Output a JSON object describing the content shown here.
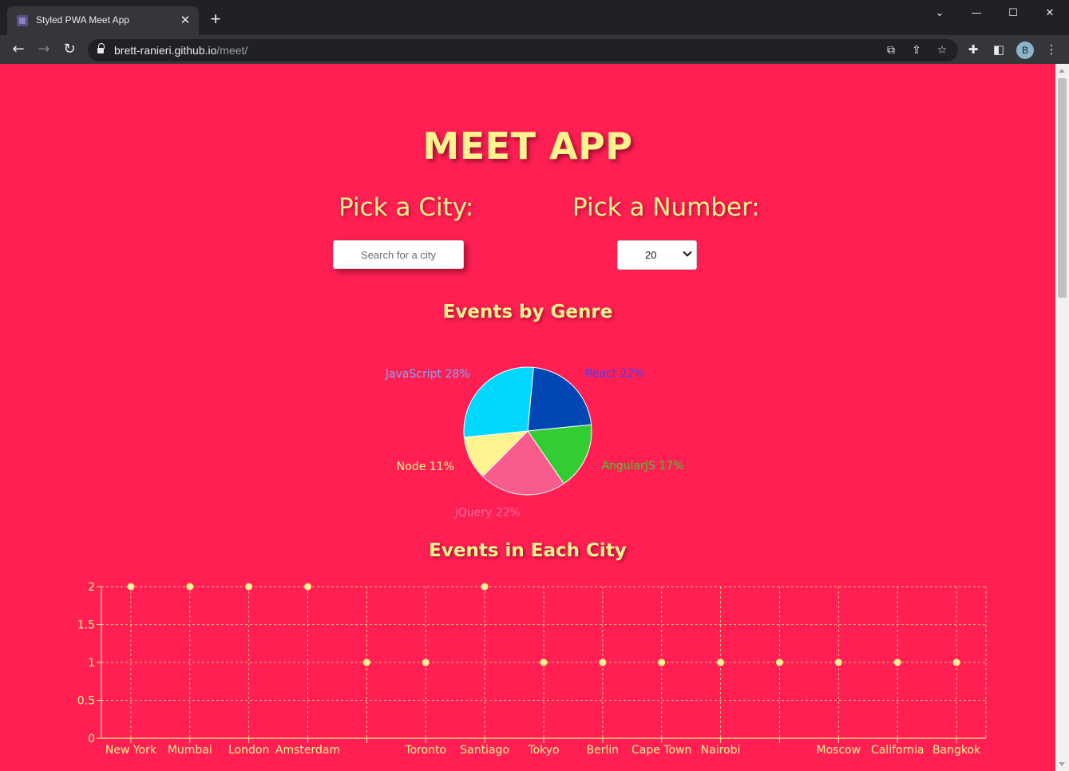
{
  "browser": {
    "tab_title": "Styled PWA Meet App",
    "url_host": "brett-ranieri.github.io",
    "url_path": "/meet/",
    "profile_initial": "B"
  },
  "app": {
    "title": "MEET APP",
    "city_label": "Pick a City:",
    "number_label": "Pick a Number:",
    "city_placeholder": "Search for a city",
    "number_value": "20",
    "genre_title": "Events by Genre",
    "city_chart_title": "Events in Each City"
  },
  "colors": {
    "page_bg": "#ff1f53",
    "accent_text": "#fff38f"
  },
  "chart_data": [
    {
      "type": "pie",
      "title": "Events by Genre",
      "slices": [
        {
          "label": "React",
          "percent": 22,
          "color": "#0047b3"
        },
        {
          "label": "AngularJS",
          "percent": 17,
          "color": "#33cc33"
        },
        {
          "label": "jQuery",
          "percent": 22,
          "color": "#f75c8d"
        },
        {
          "label": "Node",
          "percent": 11,
          "color": "#fff38f"
        },
        {
          "label": "JavaScript",
          "percent": 28,
          "color": "#00d8ff"
        }
      ],
      "label_texts": [
        "React 22%",
        "AngularJS 17%",
        "jQuery 22%",
        "Node 11%",
        "JavaScript 28%"
      ],
      "label_colors": [
        "#4040ff",
        "#44cc33",
        "#f068a0",
        "#fff38f",
        "#7fa8ff"
      ]
    },
    {
      "type": "scatter",
      "title": "Events in Each City",
      "categories": [
        "New York",
        "Mumbai",
        "London",
        "Amsterdam",
        "",
        "Toronto",
        "Santiago",
        "Tokyo",
        "Berlin",
        "Cape Town",
        "Nairobi",
        "",
        "Moscow",
        "California",
        "Bangkok"
      ],
      "values": [
        2,
        2,
        2,
        2,
        1,
        1,
        2,
        1,
        1,
        1,
        1,
        1,
        1,
        1,
        1
      ],
      "y_ticks": [
        "0",
        "0.5",
        "1",
        "1.5",
        "2"
      ],
      "ylim": [
        0,
        2
      ],
      "grid": true,
      "color": "#fff38f"
    }
  ]
}
